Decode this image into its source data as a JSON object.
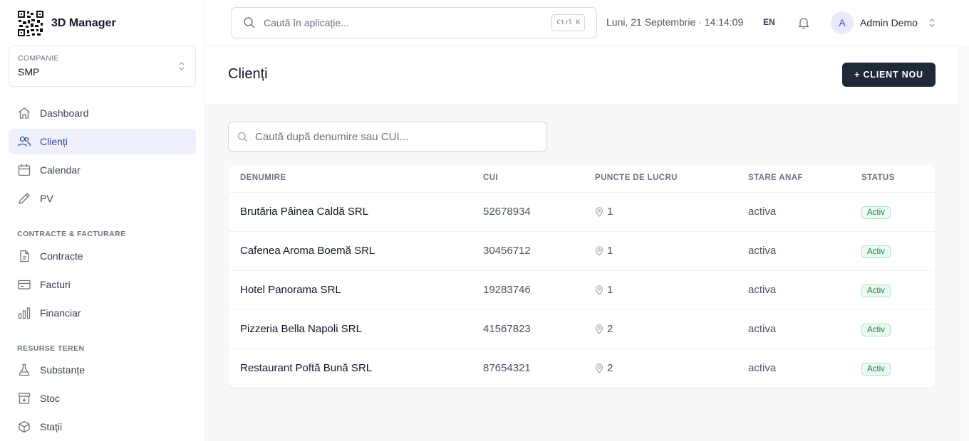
{
  "app": {
    "name": "3D Manager"
  },
  "company": {
    "label": "COMPANIE",
    "value": "SMP"
  },
  "nav": {
    "main": [
      {
        "label": "Dashboard",
        "icon": "home-icon"
      },
      {
        "label": "Clienți",
        "icon": "users-icon",
        "active": true
      },
      {
        "label": "Calendar",
        "icon": "calendar-icon"
      },
      {
        "label": "PV",
        "icon": "pencil-icon"
      }
    ],
    "contracts_section": "CONTRACTE & FACTURARE",
    "contracts": [
      {
        "label": "Contracte",
        "icon": "contract-icon"
      },
      {
        "label": "Facturi",
        "icon": "card-icon"
      },
      {
        "label": "Financiar",
        "icon": "bar-chart-icon"
      }
    ],
    "resources_section": "RESURSE TEREN",
    "resources": [
      {
        "label": "Substanțe",
        "icon": "flask-icon"
      },
      {
        "label": "Stoc",
        "icon": "box-icon"
      },
      {
        "label": "Stații",
        "icon": "cube-icon"
      }
    ]
  },
  "topbar": {
    "search_placeholder": "Caută în aplicație...",
    "shortcut": "Ctrl K",
    "datetime": "Luni, 21 Septembrie · 14:14:09",
    "lang": "EN",
    "user": {
      "initial": "A",
      "name": "Admin Demo"
    }
  },
  "page": {
    "title": "Clienți",
    "new_button": "+ CLIENT NOU",
    "filter_placeholder": "Caută după denumire sau CUI..."
  },
  "table": {
    "columns": [
      "DENUMIRE",
      "CUI",
      "PUNCTE DE LUCRU",
      "STARE ANAF",
      "STATUS"
    ],
    "rows": [
      {
        "name": "Brutăria Pâinea Caldă SRL",
        "cui": "52678934",
        "points": "1",
        "anaf": "activa",
        "status": "Activ"
      },
      {
        "name": "Cafenea Aroma Boemă SRL",
        "cui": "30456712",
        "points": "1",
        "anaf": "activa",
        "status": "Activ"
      },
      {
        "name": "Hotel Panorama SRL",
        "cui": "19283746",
        "points": "1",
        "anaf": "activa",
        "status": "Activ"
      },
      {
        "name": "Pizzeria Bella Napoli SRL",
        "cui": "41567823",
        "points": "2",
        "anaf": "activa",
        "status": "Activ"
      },
      {
        "name": "Restaurant Poftă Bună SRL",
        "cui": "87654321",
        "points": "2",
        "anaf": "activa",
        "status": "Activ"
      }
    ]
  },
  "colors": {
    "primary_button": "#1f2937",
    "active_nav_bg": "#eef1fb",
    "badge_green": "#15803d"
  }
}
